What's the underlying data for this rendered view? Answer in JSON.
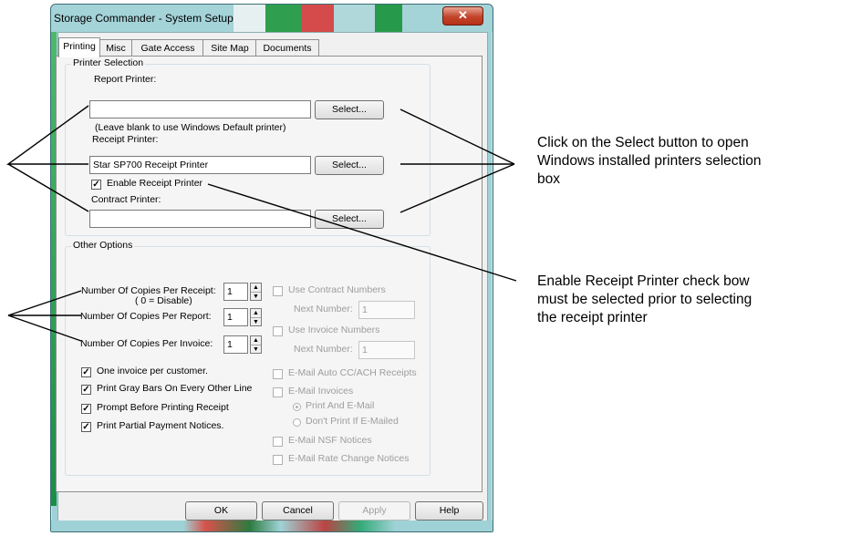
{
  "window": {
    "title": "Storage Commander - System Setup",
    "close_glyph": "✕"
  },
  "tabs": [
    {
      "label": "Printing",
      "active": true
    },
    {
      "label": "Misc",
      "active": false
    },
    {
      "label": "Gate Access",
      "active": false
    },
    {
      "label": "Site Map",
      "active": false
    },
    {
      "label": "Documents",
      "active": false
    }
  ],
  "printer_selection": {
    "legend": "Printer Selection",
    "report_label": "Report Printer:",
    "report_value": "",
    "hint": "(Leave blank to use Windows Default printer)",
    "receipt_label": "Receipt Printer:",
    "receipt_value": "Star SP700 Receipt Printer",
    "enable_receipt_label": "Enable Receipt Printer",
    "enable_receipt_checked": true,
    "contract_label": "Contract Printer:",
    "contract_value": "",
    "select_label": "Select..."
  },
  "other_options": {
    "legend": "Other Options",
    "copies_receipt_label": "Number Of Copies Per Receipt:",
    "copies_receipt_value": "1",
    "disable_note": "( 0 = Disable)",
    "copies_report_label": "Number Of Copies Per Report:",
    "copies_report_value": "1",
    "copies_invoice_label": "Number Of Copies Per Invoice:",
    "copies_invoice_value": "1",
    "checks": [
      {
        "label": "One invoice per customer.",
        "checked": true
      },
      {
        "label": "Print Gray Bars On Every Other Line",
        "checked": true
      },
      {
        "label": "Prompt Before Printing Receipt",
        "checked": true
      },
      {
        "label": "Print Partial Payment Notices.",
        "checked": true
      }
    ],
    "use_contract_numbers": "Use Contract Numbers",
    "next_number_label": "Next Number:",
    "contract_next_value": "1",
    "use_invoice_numbers": "Use Invoice Numbers",
    "invoice_next_value": "1",
    "email_auto": "E-Mail Auto CC/ACH Receipts",
    "email_invoices": "E-Mail Invoices",
    "print_and_email": "Print And E-Mail",
    "dont_print": "Don't Print If E-Mailed",
    "email_nsf": "E-Mail NSF Notices",
    "email_rate": "E-Mail Rate Change Notices"
  },
  "buttons": {
    "ok": "OK",
    "cancel": "Cancel",
    "apply": "Apply",
    "help": "Help"
  },
  "annotations": {
    "select_line1": "Click on the Select button to open",
    "select_line2": "Windows installed printers selection",
    "select_line3": "box",
    "enable_line1": "Enable Receipt Printer check bow",
    "enable_line2": "must be selected prior to selecting",
    "enable_line3": "the receipt printer"
  },
  "colors": {
    "titlebar": "#9fd2d6",
    "close_button": "#c2442b"
  }
}
